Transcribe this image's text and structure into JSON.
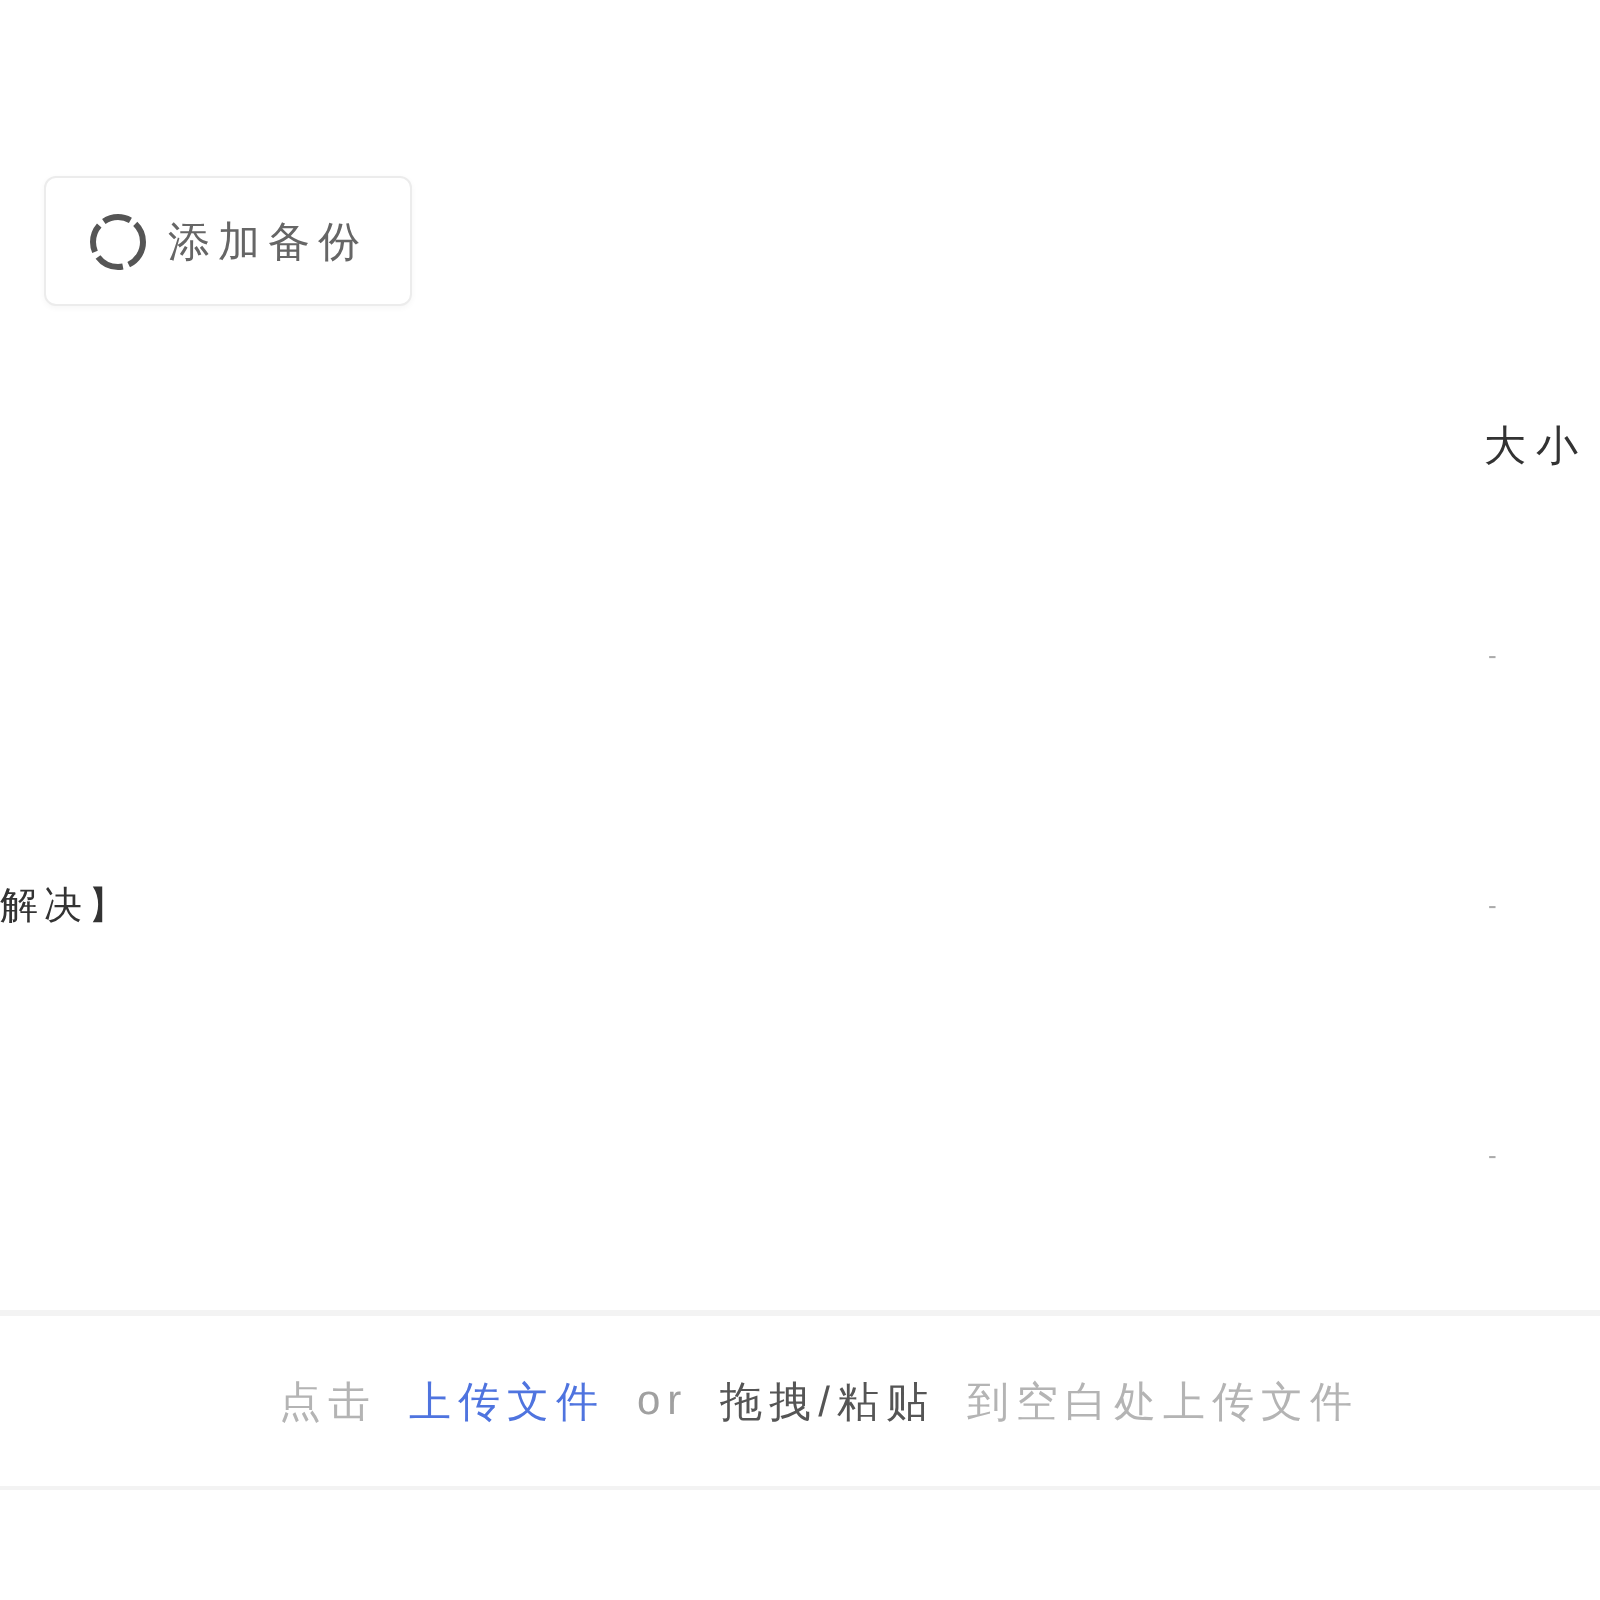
{
  "toolbar": {
    "add_backup_button": {
      "label": "添加备份"
    }
  },
  "table": {
    "size_header": "大小",
    "rows": [
      {
        "size": "-"
      },
      {
        "name": "解决】",
        "size": "-"
      },
      {
        "size": "-"
      }
    ]
  },
  "upload_hint": [
    {
      "kind": "text",
      "text": "点击"
    },
    {
      "kind": "link",
      "text": "上传文件"
    },
    {
      "kind": "muted",
      "text": "or"
    },
    {
      "kind": "emphasis",
      "text": "拖拽/粘贴"
    },
    {
      "kind": "text",
      "text": "到空白处上传文件"
    }
  ]
}
